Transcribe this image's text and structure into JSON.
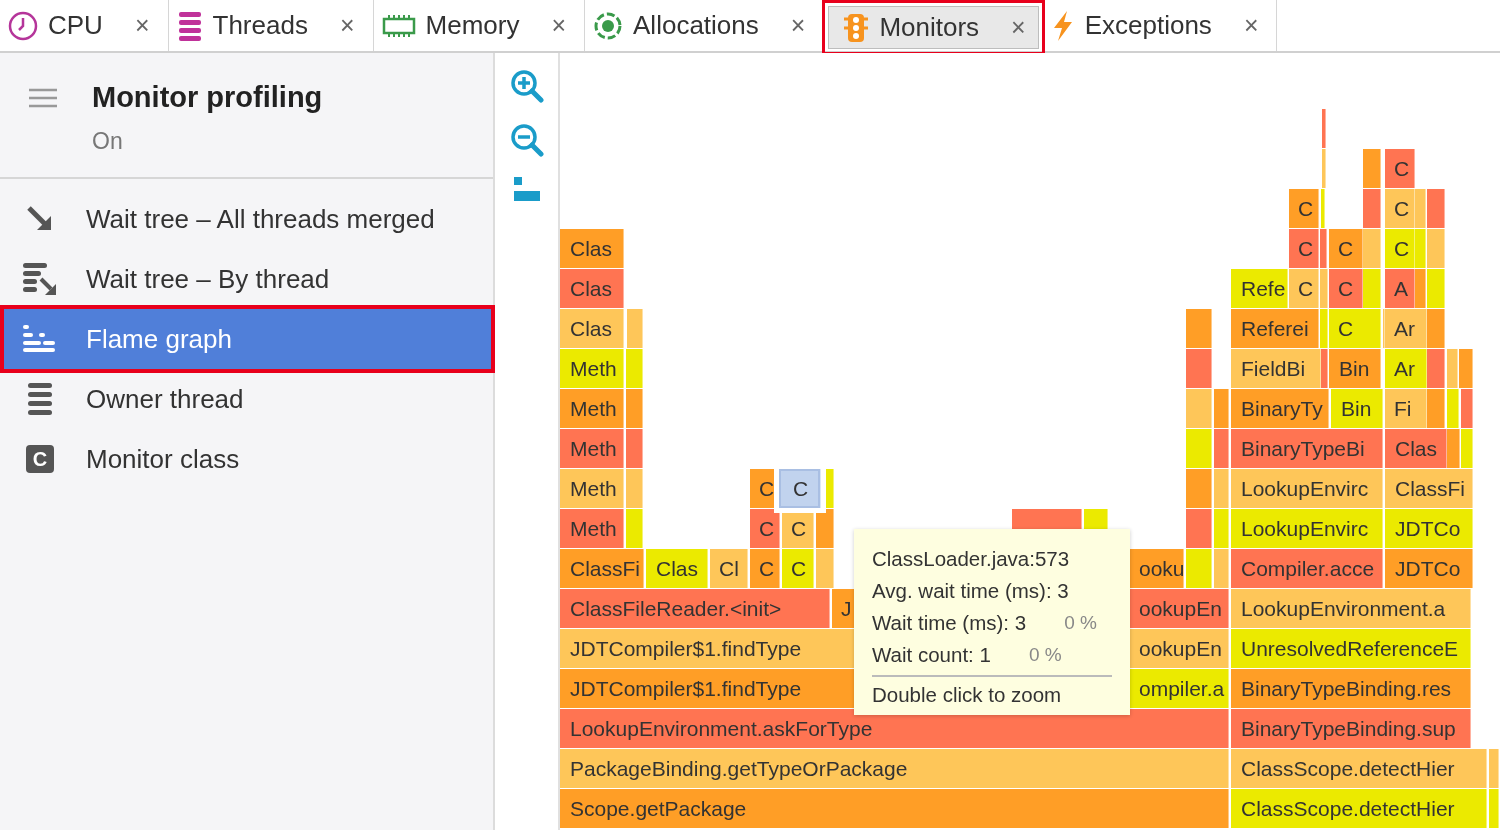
{
  "tabs": [
    {
      "label": "CPU",
      "kind": "cpu",
      "selected": false,
      "highlighted": false,
      "close": "×"
    },
    {
      "label": "Threads",
      "kind": "threads",
      "selected": false,
      "highlighted": false,
      "close": "×"
    },
    {
      "label": "Memory",
      "kind": "memory",
      "selected": false,
      "highlighted": false,
      "close": "×"
    },
    {
      "label": "Allocations",
      "kind": "allocations",
      "selected": false,
      "highlighted": false,
      "close": "×"
    },
    {
      "label": "Monitors",
      "kind": "monitors",
      "selected": true,
      "highlighted": true,
      "close": "×"
    },
    {
      "label": "Exceptions",
      "kind": "exceptions",
      "selected": false,
      "highlighted": false,
      "close": "×"
    }
  ],
  "sidebar": {
    "title": "Monitor profiling",
    "status": "On",
    "items": [
      {
        "label": "Wait tree – All threads merged",
        "kind": "merged",
        "selected": false,
        "highlighted": false
      },
      {
        "label": "Wait tree – By thread",
        "kind": "bythread",
        "selected": false,
        "highlighted": false
      },
      {
        "label": "Flame graph",
        "kind": "flame",
        "selected": true,
        "highlighted": true
      },
      {
        "label": "Owner thread",
        "kind": "owner",
        "selected": false,
        "highlighted": false
      },
      {
        "label": "Monitor class",
        "kind": "class",
        "icon_text": "C",
        "selected": false,
        "highlighted": false
      }
    ]
  },
  "flame_graph": {
    "stack_levels": [
      [
        {
          "color": "#ff7452",
          "selected": false
        }
      ],
      [
        {
          "color": "#fec659",
          "selected": false
        },
        {
          "color": "#ff9e26",
          "selected": false
        },
        {
          "label": "C",
          "color": "#ff7452",
          "selected": false
        }
      ],
      [
        {
          "label": "C",
          "color": "#ff9e26",
          "selected": false
        },
        {
          "color": "#ebea00",
          "selected": false
        },
        {
          "color": "#ff7452",
          "selected": false
        },
        {
          "label": "C",
          "color": "#fec659",
          "selected": false
        },
        {
          "color": "#fec659",
          "selected": false
        },
        {
          "color": "#ff7452",
          "selected": false
        }
      ],
      [
        {
          "label": "Clas",
          "color": "#ff9e26",
          "selected": false
        },
        {
          "label": "C",
          "color": "#ff7452",
          "selected": false
        },
        {
          "color": "#ff7452",
          "selected": false
        },
        {
          "label": "C",
          "color": "#ff9e26",
          "selected": false
        },
        {
          "color": "#fec659",
          "selected": false
        },
        {
          "label": "C",
          "color": "#ebea00",
          "selected": false
        },
        {
          "color": "#ebea00",
          "selected": false
        },
        {
          "color": "#fec659",
          "selected": false
        }
      ],
      [
        {
          "label": "Clas",
          "color": "#ff7452",
          "selected": false
        },
        {
          "label": "Refe",
          "color": "#ebea00",
          "selected": false
        },
        {
          "label": "C",
          "color": "#fec659",
          "selected": false
        },
        {
          "color": "#fec659",
          "selected": false
        },
        {
          "label": "C",
          "color": "#ff7452",
          "selected": false
        },
        {
          "color": "#ebea00",
          "selected": false
        },
        {
          "label": "A",
          "color": "#ff7452",
          "selected": false
        },
        {
          "color": "#ff9e26",
          "selected": false
        },
        {
          "color": "#ebea00",
          "selected": false
        }
      ],
      [
        {
          "label": "Clas",
          "color": "#fec659",
          "selected": false
        },
        {
          "color": "#fec659",
          "selected": false
        },
        {
          "color": "#ff9e26",
          "selected": false
        },
        {
          "label": "Referei",
          "color": "#ff9e26",
          "selected": false
        },
        {
          "color": "#ebea00",
          "selected": false
        },
        {
          "label": "C",
          "color": "#ebea00",
          "selected": false
        },
        {
          "color": "#fec659",
          "selected": false
        },
        {
          "label": "Ar",
          "color": "#fec659",
          "selected": false
        },
        {
          "color": "#ff9e26",
          "selected": false
        }
      ],
      [
        {
          "label": "Meth",
          "color": "#ebea00",
          "selected": false
        },
        {
          "color": "#ebea00",
          "selected": false
        },
        {
          "color": "#ff7452",
          "selected": false
        },
        {
          "label": "FieldBi",
          "color": "#fec659",
          "selected": false
        },
        {
          "color": "#ff7452",
          "selected": false
        },
        {
          "label": "Bin",
          "color": "#ff9e26",
          "selected": false
        },
        {
          "label": "Ar",
          "color": "#ebea00",
          "selected": false
        },
        {
          "color": "#ff7452",
          "selected": false
        },
        {
          "color": "#fec659",
          "selected": false
        },
        {
          "color": "#ff9e26",
          "selected": false
        }
      ],
      [
        {
          "label": "Meth",
          "color": "#ff9e26",
          "selected": false
        },
        {
          "color": "#ff9e26",
          "selected": false
        },
        {
          "color": "#fec659",
          "selected": false
        },
        {
          "color": "#ff9e26",
          "selected": false
        },
        {
          "label": "BinaryTy",
          "color": "#ff9e26",
          "selected": false
        },
        {
          "label": "Bin",
          "color": "#ebea00",
          "selected": false
        },
        {
          "label": "Fi",
          "color": "#fec659",
          "selected": false
        },
        {
          "color": "#ff9e26",
          "selected": false
        },
        {
          "color": "#ebea00",
          "selected": false
        },
        {
          "color": "#ff7452",
          "selected": false
        }
      ],
      [
        {
          "label": "Meth",
          "color": "#ff7452",
          "selected": false
        },
        {
          "color": "#ff7452",
          "selected": false
        },
        {
          "color": "#ebea00",
          "selected": false
        },
        {
          "color": "#ff7452",
          "selected": false
        },
        {
          "label": "BinaryTypeBi",
          "color": "#ff7452",
          "selected": false
        },
        {
          "label": "Clas",
          "color": "#ff7452",
          "selected": false
        },
        {
          "color": "#ff9e26",
          "selected": false
        },
        {
          "color": "#ebea00",
          "selected": false
        }
      ],
      [
        {
          "label": "Meth",
          "color": "#fec659",
          "selected": false
        },
        {
          "color": "#fec659",
          "selected": false
        },
        {
          "label": "C",
          "color": "#ff9e26",
          "selected": false
        },
        {
          "label": "C",
          "color": "#c1d3ee",
          "selected": true
        },
        {
          "color": "#ebea00",
          "selected": false
        },
        {
          "color": "#ff9e26",
          "selected": false
        },
        {
          "color": "#fec659",
          "selected": false
        },
        {
          "label": "LookupEnvirc",
          "color": "#fec659",
          "selected": false
        },
        {
          "label": "ClassFi",
          "color": "#fec659",
          "selected": false
        }
      ],
      [
        {
          "label": "Meth",
          "color": "#ff7452",
          "selected": false
        },
        {
          "color": "#ebea00",
          "selected": false
        },
        {
          "label": "C",
          "color": "#ff7452",
          "selected": false
        },
        {
          "label": "C",
          "color": "#fec659",
          "selected": false
        },
        {
          "color": "#ff9e26",
          "selected": false
        },
        {
          "color": "#ff7452",
          "selected": false
        },
        {
          "color": "#ebea00",
          "selected": false
        },
        {
          "color": "#ff7452",
          "selected": false
        },
        {
          "color": "#ebea00",
          "selected": false
        },
        {
          "label": "LookupEnvirc",
          "color": "#ebea00",
          "selected": false
        },
        {
          "label": "JDTCo",
          "color": "#ebea00",
          "selected": false
        }
      ],
      [
        {
          "label": "ClassFi",
          "color": "#ff9e26",
          "selected": false
        },
        {
          "label": "Clas",
          "color": "#ebea00",
          "selected": false
        },
        {
          "label": "Cl",
          "color": "#fec659",
          "selected": false
        },
        {
          "label": "C",
          "color": "#ff9e26",
          "selected": false
        },
        {
          "label": "C",
          "color": "#ebea00",
          "selected": false
        },
        {
          "color": "#fec659",
          "selected": false
        },
        {
          "label": "ooku",
          "color": "#ff9e26",
          "selected": false
        },
        {
          "color": "#ebea00",
          "selected": false
        },
        {
          "color": "#fec659",
          "selected": false
        },
        {
          "label": "Compiler.acce",
          "color": "#ff7452",
          "selected": false
        },
        {
          "label": "JDTCo",
          "color": "#ff9e26",
          "selected": false
        }
      ],
      [
        {
          "label": "ClassFileReader.<init>",
          "color": "#ff7452",
          "selected": false
        },
        {
          "label": "J",
          "color": "#ff9e26",
          "selected": false
        },
        {
          "label": "ookupEn",
          "color": "#ff7452",
          "selected": false
        },
        {
          "label": "LookupEnvironment.a",
          "color": "#fec659",
          "selected": false
        }
      ],
      [
        {
          "label": "JDTCompiler$1.findType",
          "color": "#fec659",
          "selected": false
        },
        {
          "label": "ookupEn",
          "color": "#fec659",
          "selected": false
        },
        {
          "label": "UnresolvedReferenceE",
          "color": "#ebea00",
          "selected": false
        }
      ],
      [
        {
          "label": "JDTCompiler$1.findType",
          "color": "#ff9e26",
          "selected": false
        },
        {
          "label": "ompiler.a",
          "color": "#ebea00",
          "selected": false
        },
        {
          "label": "BinaryTypeBinding.res",
          "color": "#ff9e26",
          "selected": false
        }
      ],
      [
        {
          "label": "LookupEnvironment.askForType",
          "color": "#ff7452",
          "selected": false
        },
        {
          "label": "BinaryTypeBinding.sup",
          "color": "#ff7452",
          "selected": false
        }
      ],
      [
        {
          "label": "PackageBinding.getTypeOrPackage",
          "color": "#fec659",
          "selected": false
        },
        {
          "label": "ClassScope.detectHier",
          "color": "#fec659",
          "selected": false
        },
        {
          "color": "#fec659",
          "selected": false
        }
      ],
      [
        {
          "label": "Scope.getPackage",
          "color": "#ff9e26",
          "selected": false
        },
        {
          "label": "ClassScope.detectHier",
          "color": "#ebea00",
          "selected": false
        },
        {
          "color": "#ebea00",
          "selected": false
        }
      ]
    ],
    "tooltip": {
      "title": "ClassLoader.java:573",
      "lines": [
        {
          "text": "Avg. wait time (ms): 3"
        },
        {
          "text": "Wait time (ms): 3",
          "percent": "0 %"
        },
        {
          "text": "Wait count: 1",
          "percent": "0 %"
        }
      ],
      "hint": "Double click to zoom"
    }
  }
}
